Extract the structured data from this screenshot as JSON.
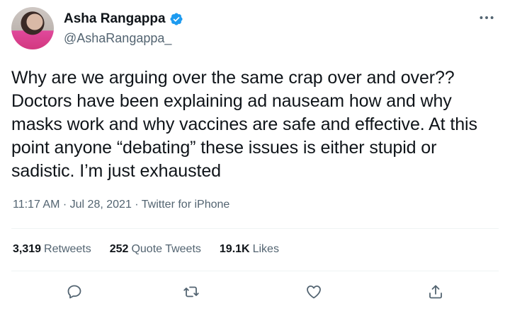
{
  "author": {
    "display_name": "Asha Rangappa",
    "handle": "@AshaRangappa_",
    "verified": true
  },
  "tweet": {
    "text": "Why are we arguing over the same crap over and over?? Doctors have been explaining ad nauseam how and why masks work and why vaccines are safe and effective. At this point anyone “debating” these issues is either stupid or sadistic. I’m just exhausted",
    "time": "11:17 AM",
    "date": "Jul 28, 2021",
    "source": "Twitter for iPhone",
    "separator": "·"
  },
  "stats": {
    "retweets_count": "3,319",
    "retweets_label": "Retweets",
    "quote_count": "252",
    "quote_label": "Quote Tweets",
    "likes_count": "19.1K",
    "likes_label": "Likes"
  },
  "icons": {
    "verified": "verified-badge-icon",
    "more": "more-icon",
    "reply": "reply-icon",
    "retweet": "retweet-icon",
    "like": "like-icon",
    "share": "share-icon"
  },
  "colors": {
    "text": "#0f1419",
    "secondary": "#536471",
    "verified": "#1d9bf0",
    "divider": "#eff3f4"
  }
}
